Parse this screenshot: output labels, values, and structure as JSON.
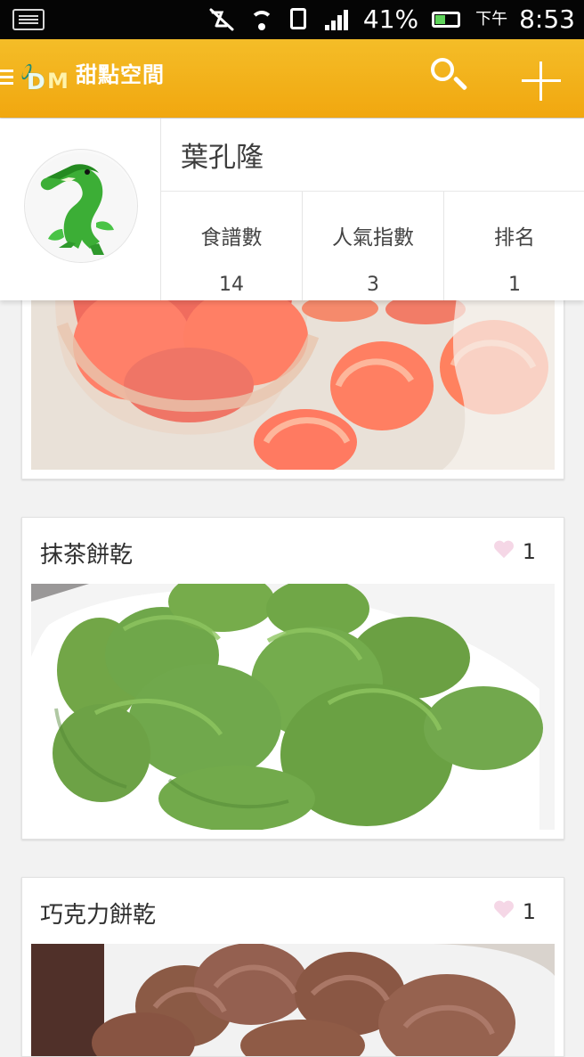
{
  "status_bar": {
    "battery_percent": "41%",
    "ampm": "下午",
    "time": "8:53"
  },
  "toolbar": {
    "title": "甜點空間",
    "logo_text": "DM",
    "logo_letters": [
      "D",
      "M"
    ]
  },
  "profile": {
    "name": "葉孔隆",
    "stats": [
      {
        "label": "食譜數",
        "value": "14"
      },
      {
        "label": "人氣指數",
        "value": "3"
      },
      {
        "label": "排名",
        "value": "1"
      }
    ]
  },
  "recipes": [
    {
      "title": "抹茶餅乾",
      "likes": "1"
    },
    {
      "title": "巧克力餅乾",
      "likes": "1"
    }
  ],
  "colors": {
    "toolbar": "#f2ad15",
    "heart": "#f5d7e6",
    "background": "#f2f2f2"
  }
}
